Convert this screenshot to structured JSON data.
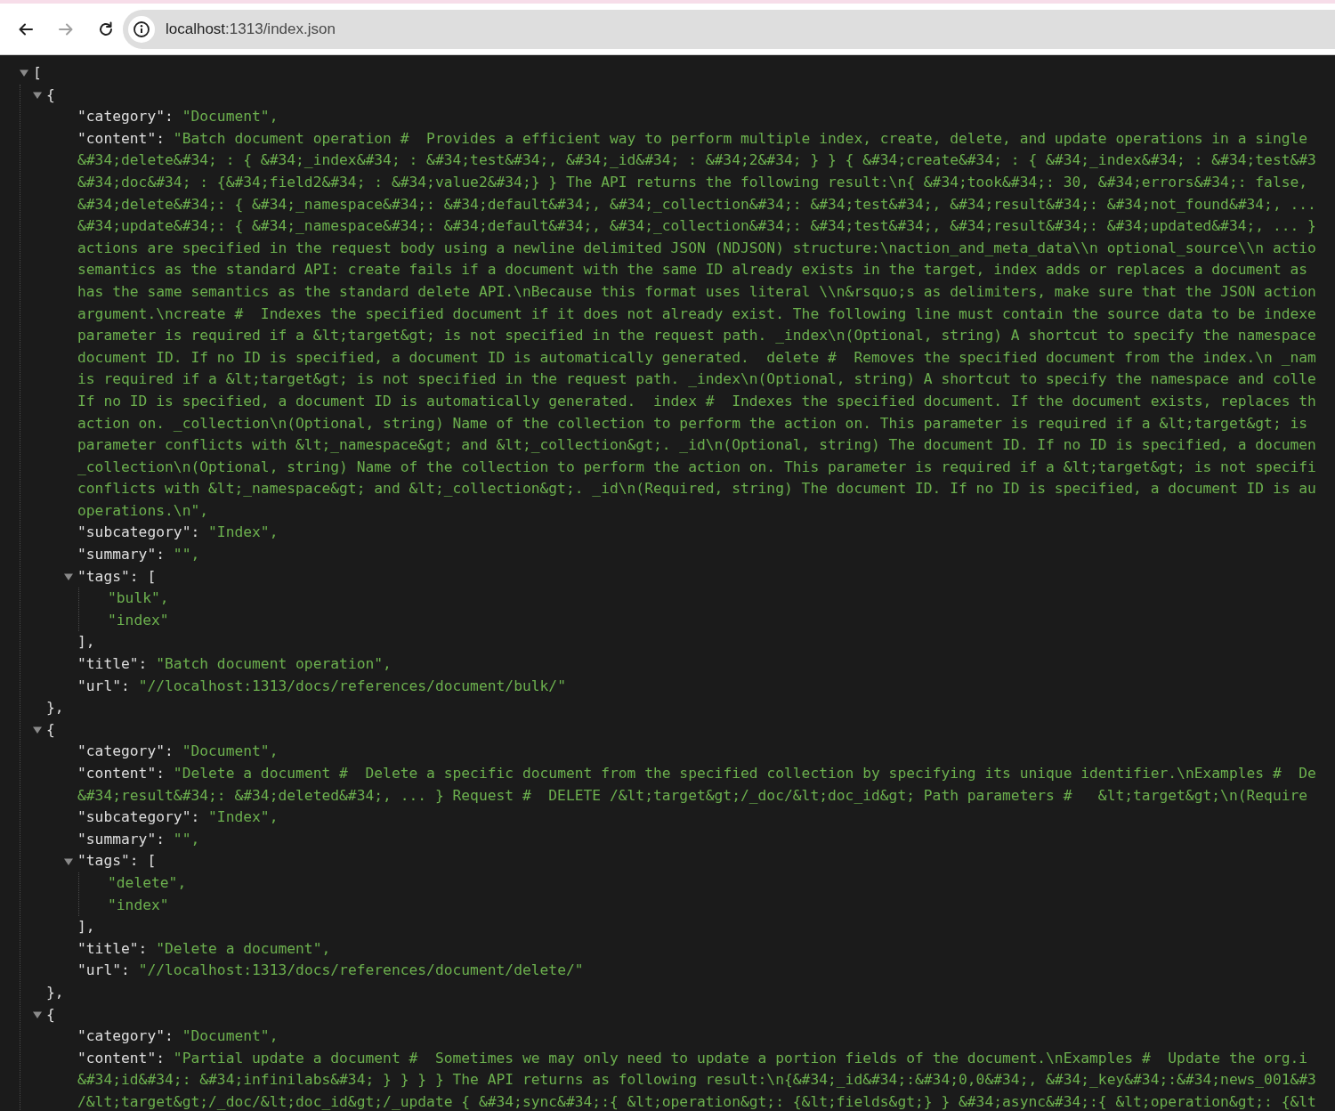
{
  "browser": {
    "buttons": [
      {
        "kind": "back",
        "disabled": false
      },
      {
        "kind": "forward",
        "disabled": true
      },
      {
        "kind": "reload",
        "disabled": false
      }
    ],
    "address": {
      "host": "localhost",
      "path": ":1313/index.json"
    }
  },
  "viewer": {
    "expanded": true,
    "open": "[",
    "items": [
      {
        "expanded": true,
        "open": "{",
        "close": "},",
        "fields": [
          {
            "kind": "string",
            "key": "\"category\":",
            "value": "\"Document\","
          },
          {
            "kind": "text",
            "key": "\"content\":",
            "lines": [
              "\"Batch document operation #  Provides a efficient way to perform multiple index, create, delete, and update operations in a single",
              "&#34;delete&#34; : { &#34;_index&#34; : &#34;test&#34;, &#34;_id&#34; : &#34;2&#34; } } { &#34;create&#34; : { &#34;_index&#34; : &#34;test&#3",
              "&#34;doc&#34; : {&#34;field2&#34; : &#34;value2&#34;} } The API returns the following result:\\n{ &#34;took&#34;: 30, &#34;errors&#34;: false,",
              "&#34;delete&#34;: { &#34;_namespace&#34;: &#34;default&#34;, &#34;_collection&#34;: &#34;test&#34;, &#34;result&#34;: &#34;not_found&#34;, ...",
              "&#34;update&#34;: { &#34;_namespace&#34;: &#34;default&#34;, &#34;_collection&#34;: &#34;test&#34;, &#34;result&#34;: &#34;updated&#34;, ... }",
              "actions are specified in the request body using a newline delimited JSON (NDJSON) structure:\\naction_and_meta_data\\\\n optional_source\\\\n actio",
              "semantics as the standard API: create fails if a document with the same ID already exists in the target, index adds or replaces a document as",
              "has the same semantics as the standard delete API.\\nBecause this format uses literal \\\\n&rsquo;s as delimiters, make sure that the JSON action",
              "argument.\\ncreate #  Indexes the specified document if it does not already exist. The following line must contain the source data to be indexe",
              "parameter is required if a &lt;target&gt; is not specified in the request path. _index\\n(Optional, string) A shortcut to specify the namespace",
              "document ID. If no ID is specified, a document ID is automatically generated.  delete #  Removes the specified document from the index.\\n _nam",
              "is required if a &lt;target&gt; is not specified in the request path. _index\\n(Optional, string) A shortcut to specify the namespace and colle",
              "If no ID is specified, a document ID is automatically generated.  index #  Indexes the specified document. If the document exists, replaces th",
              "action on. _collection\\n(Optional, string) Name of the collection to perform the action on. This parameter is required if a &lt;target&gt; is",
              "parameter conflicts with &lt;_namespace&gt; and &lt;_collection&gt;. _id\\n(Optional, string) The document ID. If no ID is specified, a documen",
              "_collection\\n(Optional, string) Name of the collection to perform the action on. This parameter is required if a &lt;target&gt; is not specifi",
              "conflicts with &lt;_namespace&gt; and &lt;_collection&gt;. _id\\n(Required, string) The document ID. If no ID is specified, a document ID is au",
              "operations.\\n\","
            ]
          },
          {
            "kind": "string",
            "key": "\"subcategory\":",
            "value": "\"Index\","
          },
          {
            "kind": "string",
            "key": "\"summary\":",
            "value": "\"\","
          },
          {
            "kind": "array",
            "key": "\"tags\":",
            "open": "[",
            "expanded": true,
            "items": [
              "\"bulk\",",
              "\"index\""
            ],
            "close": "],"
          },
          {
            "kind": "string",
            "key": "\"title\":",
            "value": "\"Batch document operation\","
          },
          {
            "kind": "string",
            "key": "\"url\":",
            "value": "\"//localhost:1313/docs/references/document/bulk/\""
          }
        ]
      },
      {
        "expanded": true,
        "open": "{",
        "close": "},",
        "fields": [
          {
            "kind": "string",
            "key": "\"category\":",
            "value": "\"Document\","
          },
          {
            "kind": "text",
            "key": "\"content\":",
            "lines": [
              "\"Delete a document #  Delete a specific document from the specified collection by specifying its unique identifier.\\nExamples #  De",
              "&#34;result&#34;: &#34;deleted&#34;, ... } Request #  DELETE /&lt;target&gt;/_doc/&lt;doc_id&gt; Path parameters #   &lt;target&gt;\\n(Require"
            ]
          },
          {
            "kind": "string",
            "key": "\"subcategory\":",
            "value": "\"Index\","
          },
          {
            "kind": "string",
            "key": "\"summary\":",
            "value": "\"\","
          },
          {
            "kind": "array",
            "key": "\"tags\":",
            "open": "[",
            "expanded": true,
            "items": [
              "\"delete\",",
              "\"index\""
            ],
            "close": "],"
          },
          {
            "kind": "string",
            "key": "\"title\":",
            "value": "\"Delete a document\","
          },
          {
            "kind": "string",
            "key": "\"url\":",
            "value": "\"//localhost:1313/docs/references/document/delete/\""
          }
        ]
      },
      {
        "expanded": true,
        "open": "{",
        "fields": [
          {
            "kind": "string",
            "key": "\"category\":",
            "value": "\"Document\","
          },
          {
            "kind": "text",
            "key": "\"content\":",
            "lines": [
              "\"Partial update a document #  Sometimes we may only need to update a portion fields of the document.\\nExamples #  Update the org.i",
              "&#34;id&#34;: &#34;infinilabs&#34; } } } } The API returns as following result:\\n{&#34;_id&#34;:&#34;0,0&#34;, &#34;_key&#34;:&#34;news_001&#3",
              "/&lt;target&gt;/_doc/&lt;doc_id&gt;/_update { &#34;sync&#34;:{ &lt;operation&gt;: {&lt;fields&gt;} } &#34;async&#34;:{ &lt;operation&gt;: {&lt"
            ]
          }
        ]
      }
    ]
  }
}
